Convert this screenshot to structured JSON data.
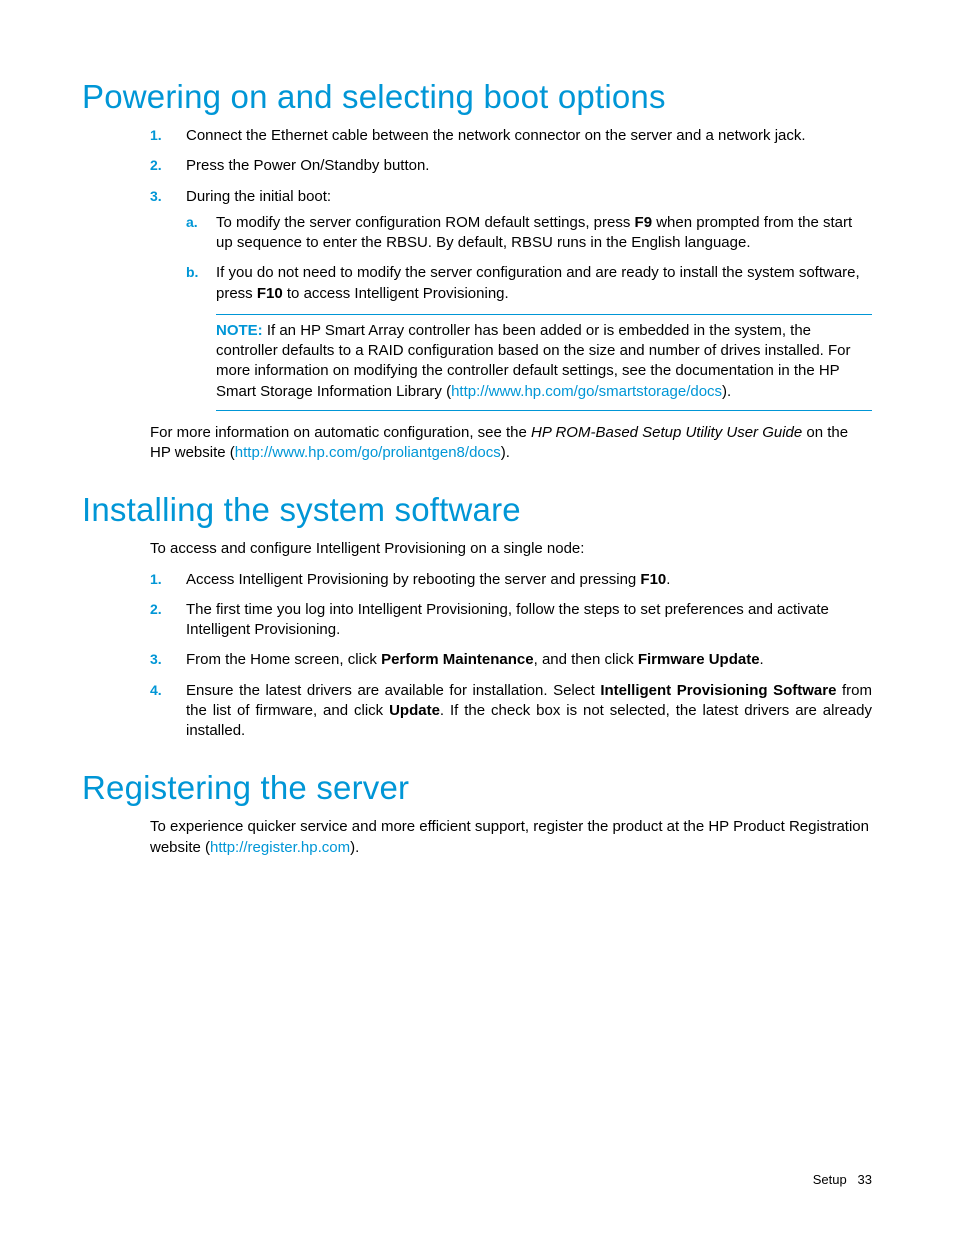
{
  "section1": {
    "heading": "Powering on and selecting boot options",
    "steps": [
      {
        "marker": "1.",
        "text": "Connect the Ethernet cable between the network connector on the server and a network jack."
      },
      {
        "marker": "2.",
        "text": "Press the Power On/Standby button."
      },
      {
        "marker": "3.",
        "text": "During the initial boot:"
      }
    ],
    "sub_a": {
      "marker": "a.",
      "pre": "To modify the server configuration ROM default settings, press ",
      "key": "F9",
      "post": " when prompted from the start up sequence to enter the RBSU. By default, RBSU runs in the English language."
    },
    "sub_b": {
      "marker": "b.",
      "pre": "If you do not need to modify the server configuration and are ready to install the system software, press ",
      "key": "F10",
      "post": " to access Intelligent Provisioning."
    },
    "note": {
      "label": "NOTE:",
      "text_pre": "  If an HP Smart Array controller has been added or is embedded in the system, the controller defaults to a RAID configuration based on the size and number of drives installed. For more information on modifying the controller default settings, see the documentation in the HP Smart Storage Information Library (",
      "link": "http://www.hp.com/go/smartstorage/docs",
      "text_post": ")."
    },
    "footer_para": {
      "pre": "For more information on automatic configuration, see the ",
      "italic": "HP ROM-Based Setup Utility User Guide",
      "mid": " on the HP website (",
      "link": "http://www.hp.com/go/proliantgen8/docs",
      "post": ")."
    }
  },
  "section2": {
    "heading": "Installing the system software",
    "intro": "To access and configure Intelligent Provisioning on a single node:",
    "step1": {
      "marker": "1.",
      "pre": "Access Intelligent Provisioning by rebooting the server and pressing ",
      "key": "F10",
      "post": "."
    },
    "step2": {
      "marker": "2.",
      "text": "The first time you log into Intelligent Provisioning, follow the steps to set preferences and activate Intelligent Provisioning."
    },
    "step3": {
      "marker": "3.",
      "pre": "From the Home screen, click ",
      "b1": "Perform Maintenance",
      "mid": ", and then click ",
      "b2": "Firmware Update",
      "post": "."
    },
    "step4": {
      "marker": "4.",
      "pre": "Ensure the latest drivers are available for installation. Select ",
      "b1": "Intelligent Provisioning Software",
      "mid": " from the list of firmware, and click ",
      "b2": "Update",
      "post": ". If the check box is not selected, the latest drivers are already installed."
    }
  },
  "section3": {
    "heading": "Registering the server",
    "para": {
      "pre": "To experience quicker service and more efficient support, register the product at the HP Product Registration website (",
      "link": "http://register.hp.com",
      "post": ")."
    }
  },
  "footer": {
    "label": "Setup",
    "pagenum": "33"
  }
}
